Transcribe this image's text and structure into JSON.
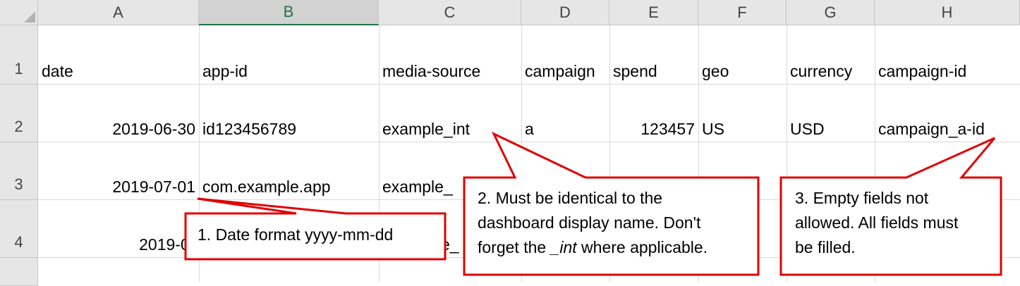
{
  "columns": [
    "A",
    "B",
    "C",
    "D",
    "E",
    "F",
    "G",
    "H"
  ],
  "rows": [
    "1",
    "2",
    "3",
    "4"
  ],
  "cells": {
    "r1": [
      "date",
      "app-id",
      "media-source",
      "campaign",
      "spend",
      "geo",
      "currency",
      "campaign-id"
    ],
    "r2": [
      "2019-06-30",
      "id123456789",
      "example_int",
      "a",
      "123457",
      "US",
      "USD",
      "campaign_a-id"
    ],
    "r3": [
      "2019-07-01",
      "com.example.app",
      "example_"
    ],
    "r4": [
      "2019-07-0",
      "e_"
    ]
  },
  "callouts": {
    "c1": {
      "text": "1. Date format yyyy-mm-dd"
    },
    "c2": {
      "line1": "2. Must be identical to the",
      "line2": "dashboard display name. Don't",
      "line3_pre": "forget the ",
      "line3_em": "_int",
      "line3_post": " where applicable."
    },
    "c3": {
      "line1": "3. Empty fields not",
      "line2": "allowed. All fields must",
      "line3": "be filled."
    }
  },
  "colors": {
    "accent_green": "#217346",
    "callout_border": "#e00000",
    "header_bg": "#e6e6e6"
  }
}
